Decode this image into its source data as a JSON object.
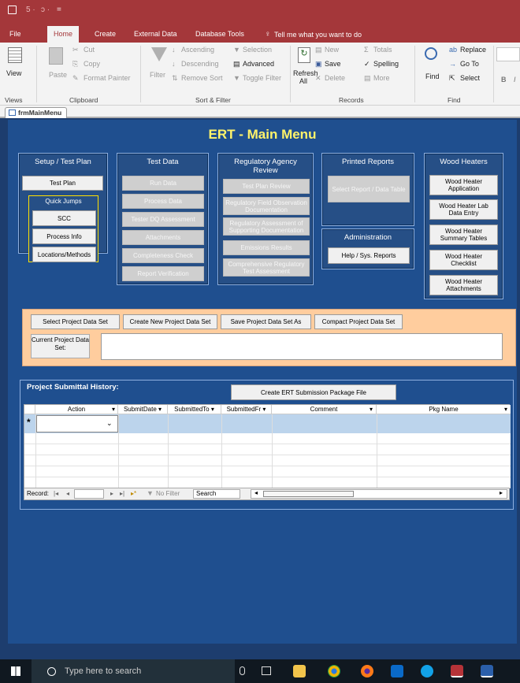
{
  "quick_access": {
    "save_icon": "save-icon",
    "undo": "5 ·",
    "redo": "ↄ ·",
    "dropdown": "="
  },
  "ribbon_tabs": [
    "File",
    "Home",
    "Create",
    "External Data",
    "Database Tools"
  ],
  "tell_me": "Tell me what you want to do",
  "ribbon": {
    "view": "View",
    "views_group": "Views",
    "paste": "Paste",
    "cut": "Cut",
    "copy": "Copy",
    "format_painter": "Format Painter",
    "clipboard_group": "Clipboard",
    "filter": "Filter",
    "ascending": "Ascending",
    "descending": "Descending",
    "remove_sort": "Remove Sort",
    "selection": "Selection",
    "advanced": "Advanced",
    "toggle_filter": "Toggle Filter",
    "sort_filter_group": "Sort & Filter",
    "refresh": "Refresh",
    "refresh_all": "All",
    "new": "New",
    "save": "Save",
    "delete": "Delete",
    "totals": "Totals",
    "spelling": "Spelling",
    "more": "More",
    "records_group": "Records",
    "find": "Find",
    "replace": "Replace",
    "go_to": "Go To",
    "select": "Select",
    "find_group": "Find",
    "bold": "B",
    "italic": "I"
  },
  "doc_tab": "frmMainMenu",
  "form_title": "ERT - Main Menu",
  "panels": {
    "setup": {
      "title": "Setup / Test Plan",
      "test_plan": "Test Plan",
      "quick_jumps": "Quick Jumps",
      "scc": "SCC",
      "process_info": "Process Info",
      "locations": "Locations/Methods"
    },
    "test_data": {
      "title": "Test Data",
      "buttons": [
        "Run Data",
        "Process Data",
        "Tester DQ Assessment",
        "Attachments",
        "Completeness Check",
        "Report Verification"
      ]
    },
    "regulatory": {
      "title": "Regulatory Agency Review",
      "buttons": [
        "Test Plan Review",
        "Regulatory Field Observation Documentation",
        "Regulatory Assessment of Supporting Documentation",
        "Emissions Results",
        "Comprehensive Regulatory Test Assessment"
      ]
    },
    "printed": {
      "title": "Printed Reports",
      "select_report": "Select Report / Data Table"
    },
    "admin": {
      "title": "Administration",
      "help": "Help / Sys. Reports"
    },
    "wood": {
      "title": "Wood Heaters",
      "buttons": [
        "Wood Heater Application",
        "Wood Heater Lab Data Entry",
        "Wood Heater Summary Tables",
        "Wood Heater Checklist",
        "Wood Heater Attachments"
      ]
    }
  },
  "project_actions": {
    "select": "Select Project Data Set",
    "create": "Create New Project Data Set",
    "save_as": "Save Project Data Set As",
    "compact": "Compact Project Data Set",
    "current_label": "Current Project Data Set:",
    "current_value": ""
  },
  "history": {
    "title": "Project Submittal History:",
    "create_package": "Create ERT Submission Package File",
    "columns": [
      "Action",
      "SubmitDate",
      "SubmittedTo",
      "SubmittedFr",
      "Comment",
      "Pkg Name"
    ],
    "new_row_marker": "*",
    "nav": {
      "record_label": "Record:",
      "first": "|◂",
      "prev": "◂",
      "next": "▸",
      "last": "▸|",
      "new": "▸*",
      "no_filter": "No Filter",
      "search": "Search"
    }
  },
  "taskbar": {
    "search_placeholder": "Type here to search",
    "icons": [
      "windows-start-icon",
      "microphone-icon",
      "task-view-icon",
      "file-explorer-icon",
      "chrome-icon",
      "firefox-icon",
      "outlook-icon",
      "skype-icon",
      "access-icon",
      "word-icon"
    ]
  }
}
